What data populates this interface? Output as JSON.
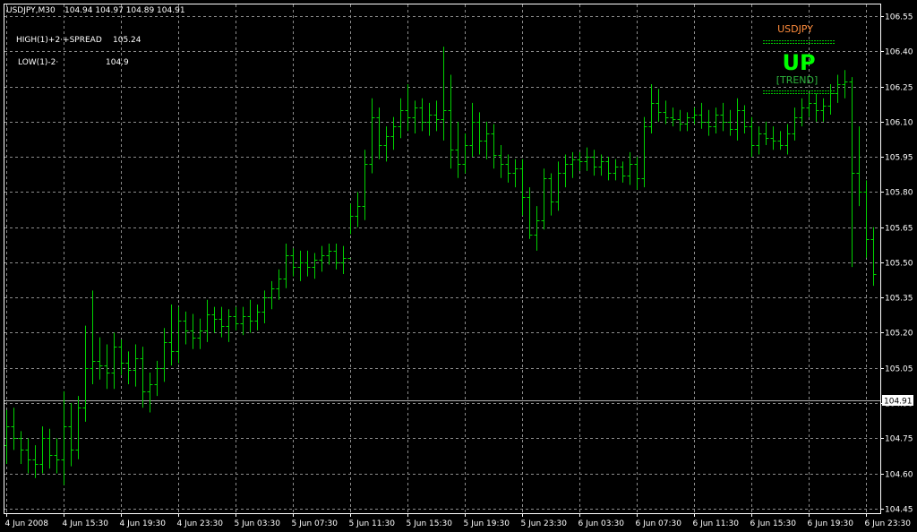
{
  "colors": {
    "background": "#000000",
    "grid": "#8c8c8c",
    "frame": "#ffffff",
    "bars": "#00d200",
    "text": "#ffffff",
    "last_price_line": "#b4b4b4",
    "trend_symbol": "#ff8c3c",
    "trend_direction": "#00ff00",
    "trend_word": "#2db43c",
    "trend_dashes": "#00c800"
  },
  "header": {
    "symbol_timeframe": "USDJPY,M30",
    "ohlc": "104.94 104.97 104.89 104.91"
  },
  "indicators": [
    {
      "label": "HIGH(1)+2·+SPREAD",
      "value": "105.24"
    },
    {
      "label": "LOW(1)-2·",
      "value": "104.9"
    }
  ],
  "trend_panel": {
    "symbol": "USDJPY",
    "direction": "UP",
    "word": "[TREND]"
  },
  "last_price_label": "104.91",
  "chart_data": {
    "type": "ohlc_bar",
    "symbol": "USDJPY",
    "timeframe": "M30",
    "grid": true,
    "ylim": [
      104.43,
      106.6
    ],
    "yticks": [
      104.45,
      104.6,
      104.75,
      104.9,
      105.05,
      105.2,
      105.35,
      105.5,
      105.65,
      105.8,
      105.95,
      106.1,
      106.25,
      106.4,
      106.55
    ],
    "ytick_labels": [
      "104.45",
      "104.60",
      "104.75",
      "104.90",
      "105.05",
      "105.20",
      "105.35",
      "105.50",
      "105.65",
      "105.80",
      "105.95",
      "106.10",
      "106.25",
      "106.40",
      "106.55"
    ],
    "xtick_labels": [
      "4 Jun 2008",
      "4 Jun 15:30",
      "4 Jun 19:30",
      "4 Jun 23:30",
      "5 Jun 03:30",
      "5 Jun 07:30",
      "5 Jun 11:30",
      "5 Jun 15:30",
      "5 Jun 19:30",
      "5 Jun 23:30",
      "6 Jun 03:30",
      "6 Jun 07:30",
      "6 Jun 11:30",
      "6 Jun 15:30",
      "6 Jun 19:30",
      "6 Jun 23:30"
    ],
    "bars_per_xtick": 8,
    "last_price": 104.91,
    "bars": [
      {
        "o": 104.72,
        "h": 104.87,
        "l": 104.64,
        "c": 104.8
      },
      {
        "o": 104.8,
        "h": 104.88,
        "l": 104.7,
        "c": 104.75
      },
      {
        "o": 104.75,
        "h": 104.78,
        "l": 104.64,
        "c": 104.7
      },
      {
        "o": 104.7,
        "h": 104.75,
        "l": 104.6,
        "c": 104.66
      },
      {
        "o": 104.66,
        "h": 104.72,
        "l": 104.58,
        "c": 104.64
      },
      {
        "o": 104.64,
        "h": 104.8,
        "l": 104.6,
        "c": 104.75
      },
      {
        "o": 104.75,
        "h": 104.79,
        "l": 104.62,
        "c": 104.68
      },
      {
        "o": 104.68,
        "h": 104.75,
        "l": 104.6,
        "c": 104.66
      },
      {
        "o": 104.66,
        "h": 104.95,
        "l": 104.55,
        "c": 104.8
      },
      {
        "o": 104.8,
        "h": 104.9,
        "l": 104.63,
        "c": 104.7
      },
      {
        "o": 104.7,
        "h": 104.93,
        "l": 104.66,
        "c": 104.88
      },
      {
        "o": 104.88,
        "h": 105.23,
        "l": 104.82,
        "c": 105.05
      },
      {
        "o": 105.05,
        "h": 105.38,
        "l": 104.98,
        "c": 105.08
      },
      {
        "o": 105.08,
        "h": 105.18,
        "l": 105.0,
        "c": 105.06
      },
      {
        "o": 105.06,
        "h": 105.15,
        "l": 104.96,
        "c": 105.03
      },
      {
        "o": 105.03,
        "h": 105.2,
        "l": 104.96,
        "c": 105.14
      },
      {
        "o": 105.14,
        "h": 105.17,
        "l": 105.02,
        "c": 105.07
      },
      {
        "o": 105.07,
        "h": 105.12,
        "l": 104.98,
        "c": 105.04
      },
      {
        "o": 105.04,
        "h": 105.15,
        "l": 104.97,
        "c": 105.09
      },
      {
        "o": 105.09,
        "h": 105.14,
        "l": 104.88,
        "c": 104.95
      },
      {
        "o": 104.95,
        "h": 105.03,
        "l": 104.86,
        "c": 104.98
      },
      {
        "o": 104.98,
        "h": 105.08,
        "l": 104.93,
        "c": 105.05
      },
      {
        "o": 105.05,
        "h": 105.22,
        "l": 104.99,
        "c": 105.16
      },
      {
        "o": 105.16,
        "h": 105.32,
        "l": 105.06,
        "c": 105.12
      },
      {
        "o": 105.12,
        "h": 105.31,
        "l": 105.07,
        "c": 105.25
      },
      {
        "o": 105.25,
        "h": 105.29,
        "l": 105.15,
        "c": 105.21
      },
      {
        "o": 105.21,
        "h": 105.28,
        "l": 105.13,
        "c": 105.18
      },
      {
        "o": 105.18,
        "h": 105.26,
        "l": 105.13,
        "c": 105.21
      },
      {
        "o": 105.21,
        "h": 105.34,
        "l": 105.16,
        "c": 105.28
      },
      {
        "o": 105.28,
        "h": 105.31,
        "l": 105.2,
        "c": 105.26
      },
      {
        "o": 105.26,
        "h": 105.31,
        "l": 105.18,
        "c": 105.23
      },
      {
        "o": 105.23,
        "h": 105.3,
        "l": 105.16,
        "c": 105.27
      },
      {
        "o": 105.27,
        "h": 105.31,
        "l": 105.21,
        "c": 105.24
      },
      {
        "o": 105.24,
        "h": 105.31,
        "l": 105.19,
        "c": 105.27
      },
      {
        "o": 105.27,
        "h": 105.34,
        "l": 105.2,
        "c": 105.25
      },
      {
        "o": 105.25,
        "h": 105.32,
        "l": 105.21,
        "c": 105.29
      },
      {
        "o": 105.29,
        "h": 105.38,
        "l": 105.24,
        "c": 105.35
      },
      {
        "o": 105.35,
        "h": 105.42,
        "l": 105.3,
        "c": 105.39
      },
      {
        "o": 105.39,
        "h": 105.47,
        "l": 105.34,
        "c": 105.43
      },
      {
        "o": 105.43,
        "h": 105.58,
        "l": 105.39,
        "c": 105.53
      },
      {
        "o": 105.53,
        "h": 105.56,
        "l": 105.44,
        "c": 105.48
      },
      {
        "o": 105.48,
        "h": 105.55,
        "l": 105.42,
        "c": 105.5
      },
      {
        "o": 105.5,
        "h": 105.55,
        "l": 105.44,
        "c": 105.48
      },
      {
        "o": 105.48,
        "h": 105.54,
        "l": 105.43,
        "c": 105.51
      },
      {
        "o": 105.51,
        "h": 105.57,
        "l": 105.46,
        "c": 105.53
      },
      {
        "o": 105.53,
        "h": 105.58,
        "l": 105.49,
        "c": 105.55
      },
      {
        "o": 105.55,
        "h": 105.58,
        "l": 105.47,
        "c": 105.5
      },
      {
        "o": 105.5,
        "h": 105.57,
        "l": 105.45,
        "c": 105.52
      },
      {
        "o": 105.52,
        "h": 105.75,
        "l": 105.62,
        "c": 105.7
      },
      {
        "o": 105.7,
        "h": 105.8,
        "l": 105.65,
        "c": 105.74
      },
      {
        "o": 105.74,
        "h": 105.98,
        "l": 105.68,
        "c": 105.92
      },
      {
        "o": 105.92,
        "h": 106.2,
        "l": 105.88,
        "c": 106.12
      },
      {
        "o": 106.12,
        "h": 106.16,
        "l": 105.94,
        "c": 106.0
      },
      {
        "o": 106.0,
        "h": 106.08,
        "l": 105.93,
        "c": 106.04
      },
      {
        "o": 106.04,
        "h": 106.12,
        "l": 105.98,
        "c": 106.08
      },
      {
        "o": 106.08,
        "h": 106.2,
        "l": 106.03,
        "c": 106.15
      },
      {
        "o": 106.15,
        "h": 106.26,
        "l": 106.06,
        "c": 106.12
      },
      {
        "o": 106.12,
        "h": 106.19,
        "l": 106.05,
        "c": 106.16
      },
      {
        "o": 106.16,
        "h": 106.2,
        "l": 106.06,
        "c": 106.1
      },
      {
        "o": 106.1,
        "h": 106.18,
        "l": 106.04,
        "c": 106.13
      },
      {
        "o": 106.13,
        "h": 106.19,
        "l": 106.06,
        "c": 106.11
      },
      {
        "o": 106.11,
        "h": 106.42,
        "l": 106.02,
        "c": 106.15
      },
      {
        "o": 106.15,
        "h": 106.3,
        "l": 105.9,
        "c": 105.98
      },
      {
        "o": 105.98,
        "h": 106.1,
        "l": 105.86,
        "c": 105.92
      },
      {
        "o": 105.92,
        "h": 106.05,
        "l": 105.88,
        "c": 106.0
      },
      {
        "o": 106.0,
        "h": 106.18,
        "l": 105.95,
        "c": 106.1
      },
      {
        "o": 106.1,
        "h": 106.14,
        "l": 105.96,
        "c": 106.02
      },
      {
        "o": 106.02,
        "h": 106.1,
        "l": 105.94,
        "c": 106.05
      },
      {
        "o": 106.05,
        "h": 106.09,
        "l": 105.9,
        "c": 105.96
      },
      {
        "o": 105.96,
        "h": 106.0,
        "l": 105.86,
        "c": 105.92
      },
      {
        "o": 105.92,
        "h": 105.96,
        "l": 105.84,
        "c": 105.88
      },
      {
        "o": 105.88,
        "h": 105.94,
        "l": 105.82,
        "c": 105.9
      },
      {
        "o": 105.9,
        "h": 105.94,
        "l": 105.7,
        "c": 105.78
      },
      {
        "o": 105.78,
        "h": 105.82,
        "l": 105.6,
        "c": 105.62
      },
      {
        "o": 105.62,
        "h": 105.74,
        "l": 105.55,
        "c": 105.68
      },
      {
        "o": 105.68,
        "h": 105.9,
        "l": 105.64,
        "c": 105.86
      },
      {
        "o": 105.86,
        "h": 105.88,
        "l": 105.7,
        "c": 105.76
      },
      {
        "o": 105.76,
        "h": 105.93,
        "l": 105.72,
        "c": 105.88
      },
      {
        "o": 105.88,
        "h": 105.96,
        "l": 105.82,
        "c": 105.92
      },
      {
        "o": 105.92,
        "h": 105.97,
        "l": 105.86,
        "c": 105.94
      },
      {
        "o": 105.94,
        "h": 105.97,
        "l": 105.89,
        "c": 105.93
      },
      {
        "o": 105.93,
        "h": 105.99,
        "l": 105.89,
        "c": 105.95
      },
      {
        "o": 105.95,
        "h": 105.98,
        "l": 105.87,
        "c": 105.91
      },
      {
        "o": 105.91,
        "h": 105.96,
        "l": 105.87,
        "c": 105.93
      },
      {
        "o": 105.93,
        "h": 105.95,
        "l": 105.85,
        "c": 105.88
      },
      {
        "o": 105.88,
        "h": 105.94,
        "l": 105.85,
        "c": 105.91
      },
      {
        "o": 105.91,
        "h": 105.93,
        "l": 105.84,
        "c": 105.87
      },
      {
        "o": 105.87,
        "h": 105.97,
        "l": 105.83,
        "c": 105.92
      },
      {
        "o": 105.92,
        "h": 105.95,
        "l": 105.81,
        "c": 105.86
      },
      {
        "o": 105.86,
        "h": 106.12,
        "l": 105.82,
        "c": 106.08
      },
      {
        "o": 106.08,
        "h": 106.26,
        "l": 106.05,
        "c": 106.18
      },
      {
        "o": 106.18,
        "h": 106.24,
        "l": 106.1,
        "c": 106.14
      },
      {
        "o": 106.14,
        "h": 106.19,
        "l": 106.09,
        "c": 106.12
      },
      {
        "o": 106.12,
        "h": 106.16,
        "l": 106.08,
        "c": 106.11
      },
      {
        "o": 106.11,
        "h": 106.15,
        "l": 106.06,
        "c": 106.09
      },
      {
        "o": 106.09,
        "h": 106.14,
        "l": 106.06,
        "c": 106.12
      },
      {
        "o": 106.12,
        "h": 106.16,
        "l": 106.09,
        "c": 106.13
      },
      {
        "o": 106.13,
        "h": 106.18,
        "l": 106.07,
        "c": 106.1
      },
      {
        "o": 106.1,
        "h": 106.15,
        "l": 106.04,
        "c": 106.08
      },
      {
        "o": 106.08,
        "h": 106.16,
        "l": 106.05,
        "c": 106.13
      },
      {
        "o": 106.13,
        "h": 106.18,
        "l": 106.06,
        "c": 106.1
      },
      {
        "o": 106.1,
        "h": 106.15,
        "l": 106.04,
        "c": 106.07
      },
      {
        "o": 106.07,
        "h": 106.2,
        "l": 106.02,
        "c": 106.15
      },
      {
        "o": 106.15,
        "h": 106.17,
        "l": 106.05,
        "c": 106.08
      },
      {
        "o": 106.08,
        "h": 106.12,
        "l": 105.95,
        "c": 106.0
      },
      {
        "o": 106.0,
        "h": 106.08,
        "l": 105.96,
        "c": 106.05
      },
      {
        "o": 106.05,
        "h": 106.1,
        "l": 106.0,
        "c": 106.03
      },
      {
        "o": 106.03,
        "h": 106.08,
        "l": 105.98,
        "c": 106.02
      },
      {
        "o": 106.02,
        "h": 106.06,
        "l": 105.98,
        "c": 106.0
      },
      {
        "o": 106.0,
        "h": 106.09,
        "l": 105.96,
        "c": 106.05
      },
      {
        "o": 106.05,
        "h": 106.16,
        "l": 106.02,
        "c": 106.12
      },
      {
        "o": 106.12,
        "h": 106.2,
        "l": 106.08,
        "c": 106.16
      },
      {
        "o": 106.16,
        "h": 106.22,
        "l": 106.12,
        "c": 106.18
      },
      {
        "o": 106.18,
        "h": 106.22,
        "l": 106.1,
        "c": 106.15
      },
      {
        "o": 106.15,
        "h": 106.2,
        "l": 106.1,
        "c": 106.17
      },
      {
        "o": 106.17,
        "h": 106.26,
        "l": 106.13,
        "c": 106.22
      },
      {
        "o": 106.22,
        "h": 106.3,
        "l": 106.18,
        "c": 106.26
      },
      {
        "o": 106.26,
        "h": 106.32,
        "l": 106.2,
        "c": 106.27
      },
      {
        "o": 106.27,
        "h": 106.29,
        "l": 105.48,
        "c": 105.88
      },
      {
        "o": 105.88,
        "h": 106.08,
        "l": 105.74,
        "c": 105.8
      },
      {
        "o": 105.8,
        "h": 105.85,
        "l": 105.52,
        "c": 105.6
      },
      {
        "o": 105.6,
        "h": 105.65,
        "l": 105.4,
        "c": 105.45
      },
      {
        "o": 105.45,
        "h": 105.48,
        "l": 105.3,
        "c": 105.32
      },
      {
        "o": 105.32,
        "h": 105.35,
        "l": 105.14,
        "c": 105.2
      },
      {
        "o": 105.2,
        "h": 105.28,
        "l": 105.17,
        "c": 105.25
      },
      {
        "o": 105.25,
        "h": 105.35,
        "l": 105.21,
        "c": 105.31
      },
      {
        "o": 105.31,
        "h": 105.37,
        "l": 105.25,
        "c": 105.33
      },
      {
        "o": 105.33,
        "h": 105.4,
        "l": 105.26,
        "c": 105.3
      },
      {
        "o": 105.3,
        "h": 105.39,
        "l": 105.22,
        "c": 105.35
      },
      {
        "o": 105.35,
        "h": 105.37,
        "l": 105.2,
        "c": 105.25
      },
      {
        "o": 105.25,
        "h": 105.31,
        "l": 105.16,
        "c": 105.2
      },
      {
        "o": 105.2,
        "h": 105.26,
        "l": 105.14,
        "c": 105.18
      },
      {
        "o": 105.18,
        "h": 105.2,
        "l": 104.97,
        "c": 105.05
      },
      {
        "o": 105.05,
        "h": 105.08,
        "l": 104.94,
        "c": 104.98
      },
      {
        "o": 104.98,
        "h": 105.02,
        "l": 104.92,
        "c": 104.95
      },
      {
        "o": 104.95,
        "h": 104.98,
        "l": 104.89,
        "c": 104.91
      }
    ]
  }
}
